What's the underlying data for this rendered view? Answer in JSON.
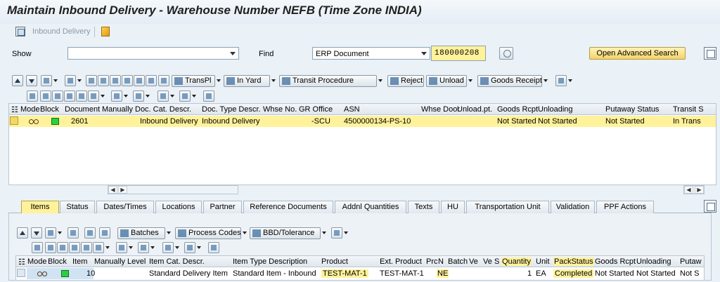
{
  "title": "Maintain Inbound Delivery - Warehouse Number NEFB (Time Zone INDIA)",
  "app_toolbar": {
    "inbound_delivery": "Inbound Delivery"
  },
  "search": {
    "show_label": "Show",
    "show_value": "",
    "find_label": "Find",
    "find_value": "ERP Document",
    "document_number": "180000208",
    "advanced_search": "Open Advanced Search"
  },
  "top_toolbar": {
    "buttons": [
      "TransPl",
      "In Yard",
      "Transit Procedure",
      "Reject",
      "Unload",
      "Goods Receipt"
    ]
  },
  "header_grid": {
    "columns": [
      "Mode",
      "Block",
      "Document",
      "Manually",
      "Doc. Cat. Descr.",
      "Doc. Type Descr.",
      "Whse No.",
      "GR Office",
      "ASN",
      "Whse Door",
      "Unload.pt.",
      "Goods Rcpt",
      "Unloading",
      "Putaway Status",
      "Transit S"
    ],
    "rows": [
      {
        "document": "2601",
        "doc_cat": "Inbound Delivery",
        "doc_type": "Inbound Delivery",
        "gr_office": "-SCU",
        "asn": "4500000134-PS-10",
        "goods_rcpt": "Not Started",
        "unloading": "Not Started",
        "putaway": "Not Started",
        "transit": "In Trans"
      }
    ]
  },
  "tabs": [
    "Items",
    "Status",
    "Dates/Times",
    "Locations",
    "Partner",
    "Reference Documents",
    "Addnl Quantities",
    "Texts",
    "HU",
    "Transportation Unit",
    "Validation",
    "PPF Actions"
  ],
  "active_tab": "Items",
  "items_toolbar": {
    "buttons": [
      "Batches",
      "Process Codes",
      "BBD/Tolerance"
    ]
  },
  "items_grid": {
    "columns": [
      "Mode",
      "Block",
      "Item",
      "Manually",
      "Level",
      "Item Cat. Descr.",
      "Item Type Description",
      "Product",
      "Ext. Product",
      "Prc",
      "N",
      "Batch",
      "Ve",
      "Ve",
      "S",
      "Quantity",
      "Unit",
      "PackStatus",
      "Goods Rcpt",
      "Unloading",
      "Putaw"
    ],
    "rows": [
      {
        "item": "10",
        "item_cat": "Standard Delivery Item",
        "item_type": "Standard Item - Inbound",
        "product": "TEST-MAT-1",
        "ext_product": "TEST-MAT-1",
        "ne": "NE",
        "quantity": "1",
        "unit": "EA",
        "pack_status": "Completed",
        "goods_rcpt": "Not Started",
        "unloading": "Not Started",
        "putaway": "Not S"
      }
    ]
  },
  "colors": {
    "highlight": "#fff29a",
    "accent_button": "#f4d369",
    "status_green": "#27d33a"
  }
}
